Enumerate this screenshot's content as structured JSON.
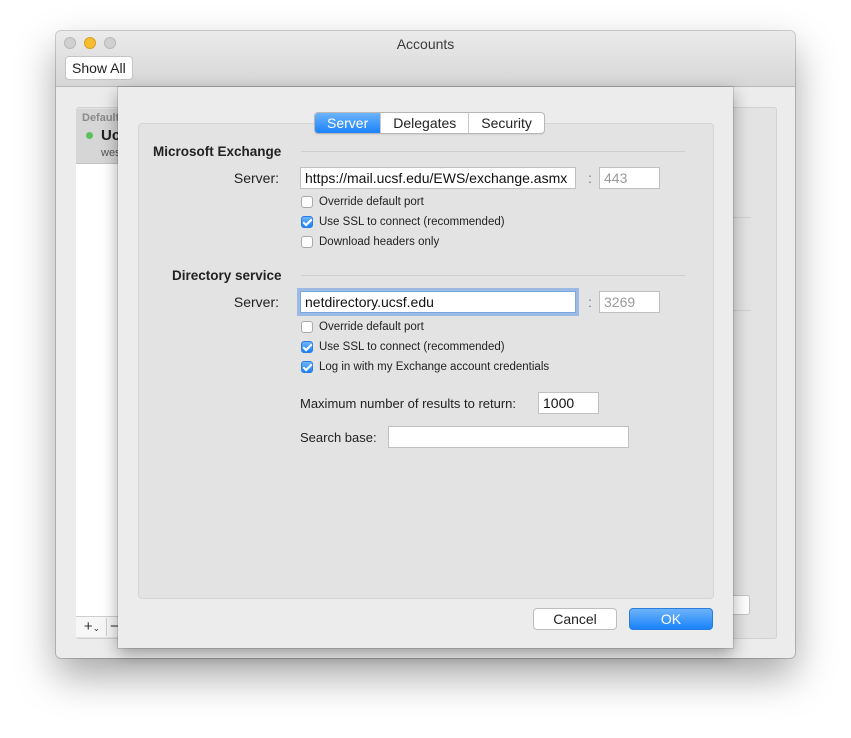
{
  "window": {
    "title": "Accounts",
    "show_all_label": "Show All"
  },
  "accounts": {
    "default_label": "Default",
    "selected_name": "Uc",
    "selected_email": "wes",
    "add_label": "+",
    "add_menu": "⌄",
    "remove_label": "−"
  },
  "tabs": [
    {
      "label": "Server",
      "active": true
    },
    {
      "label": "Delegates",
      "active": false
    },
    {
      "label": "Security",
      "active": false
    }
  ],
  "exchange": {
    "heading": "Microsoft Exchange",
    "server_label": "Server:",
    "server_value": "https://mail.ucsf.edu/EWS/exchange.asmx",
    "colon": ":",
    "port_placeholder": "443",
    "options": [
      {
        "label": "Override default port",
        "checked": false
      },
      {
        "label": "Use SSL to connect (recommended)",
        "checked": true
      },
      {
        "label": "Download headers only",
        "checked": false
      }
    ]
  },
  "directory": {
    "heading": "Directory service",
    "server_label": "Server:",
    "server_value": "netdirectory.ucsf.edu",
    "colon": ":",
    "port_placeholder": "3269",
    "options": [
      {
        "label": "Override default port",
        "checked": false
      },
      {
        "label": "Use SSL to connect (recommended)",
        "checked": true
      },
      {
        "label": "Log in with my Exchange account credentials",
        "checked": true
      }
    ],
    "max_results_label": "Maximum number of results to return:",
    "max_results_value": "1000",
    "search_base_label": "Search base:",
    "search_base_value": ""
  },
  "buttons": {
    "cancel": "Cancel",
    "ok": "OK"
  },
  "colors": {
    "accent": "#1a82fb",
    "status_online": "#5dc05f"
  }
}
